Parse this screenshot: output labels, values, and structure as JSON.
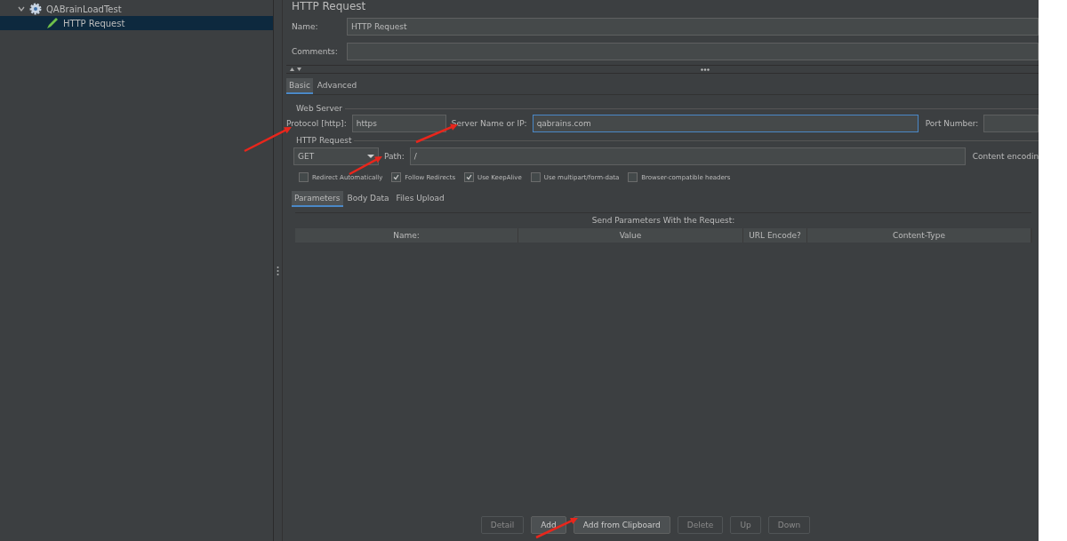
{
  "tree": [
    {
      "label": "QABrainLoadTest",
      "expanded": true,
      "selected": false,
      "children": [
        {
          "label": "HTTP Request",
          "selected": true
        }
      ]
    }
  ],
  "title": "HTTP Request",
  "name_field": {
    "label": "Name:",
    "value": "HTTP Request"
  },
  "comments_field": {
    "label": "Comments:"
  },
  "tabs": [
    {
      "label": "Basic",
      "selected": true
    },
    {
      "label": "Advanced",
      "selected": false
    }
  ],
  "web_server": {
    "legend": "Web Server",
    "protocol_label": "Protocol [http]:",
    "protocol": "https",
    "server_label": "Server Name or IP:",
    "server": "qabrains.com",
    "port_label": "Port Number:"
  },
  "http_request": {
    "legend": "HTTP Request",
    "method": "GET",
    "path_label": "Path:",
    "path": "/",
    "encoding_label": "Content encodin"
  },
  "options": [
    {
      "label": "Redirect Automatically",
      "checked": false
    },
    {
      "label": "Follow Redirects",
      "checked": true
    },
    {
      "label": "Use KeepAlive",
      "checked": true
    },
    {
      "label": "Use multipart/form-data",
      "checked": false
    },
    {
      "label": "Browser-compatible headers",
      "checked": false
    }
  ],
  "sub_tabs": [
    {
      "label": "Parameters",
      "selected": true
    },
    {
      "label": "Body Data",
      "selected": false
    },
    {
      "label": "Files Upload",
      "selected": false
    }
  ],
  "table": {
    "caption": "Send Parameters With the Request:",
    "columns": [
      "Name:",
      "Value",
      "URL Encode?",
      "Content-Type"
    ]
  },
  "buttons": [
    {
      "label": "Detail",
      "disabled": true
    },
    {
      "label": "Add",
      "disabled": false
    },
    {
      "label": "Add from Clipboard",
      "disabled": false
    },
    {
      "label": "Delete",
      "disabled": true
    },
    {
      "label": "Up",
      "disabled": true
    },
    {
      "label": "Down",
      "disabled": true
    }
  ]
}
